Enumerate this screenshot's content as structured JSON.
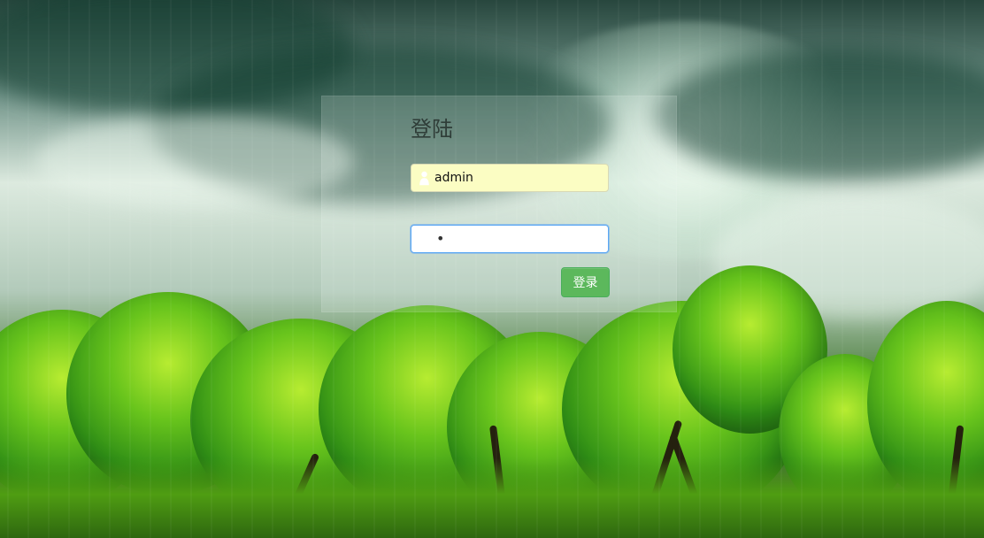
{
  "login": {
    "title": "登陆",
    "username": {
      "value": "admin",
      "icon": "user-icon"
    },
    "password": {
      "masked_value": "•"
    },
    "submit_label": "登录"
  },
  "colors": {
    "submit_button": "#5cb85c",
    "username_autofill": "#fbfdc3",
    "focus_border": "#5aa7f4"
  }
}
